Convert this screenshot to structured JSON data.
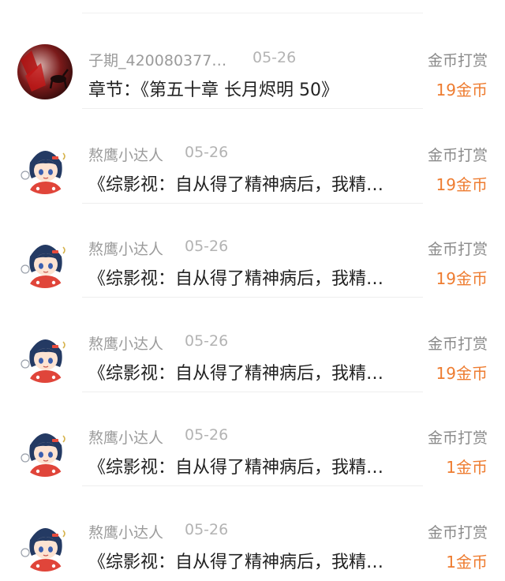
{
  "records": [
    {
      "user": "子期_420080377…",
      "date": "05-26",
      "title": "章节：《第五十章 长月烬明 50》",
      "type": "金币打赏",
      "amount": "19金币",
      "avatar": "dark-red-art"
    },
    {
      "user": "熬鹰小达人",
      "date": "05-26",
      "title": "《综影视：自从得了精神病后，我精…",
      "type": "金币打赏",
      "amount": "19金币",
      "avatar": "cartoon-girl"
    },
    {
      "user": "熬鹰小达人",
      "date": "05-26",
      "title": "《综影视：自从得了精神病后，我精…",
      "type": "金币打赏",
      "amount": "19金币",
      "avatar": "cartoon-girl"
    },
    {
      "user": "熬鹰小达人",
      "date": "05-26",
      "title": "《综影视：自从得了精神病后，我精…",
      "type": "金币打赏",
      "amount": "19金币",
      "avatar": "cartoon-girl"
    },
    {
      "user": "熬鹰小达人",
      "date": "05-26",
      "title": "《综影视：自从得了精神病后，我精…",
      "type": "金币打赏",
      "amount": "1金币",
      "avatar": "cartoon-girl"
    },
    {
      "user": "熬鹰小达人",
      "date": "05-26",
      "title": "《综影视：自从得了精神病后，我精…",
      "type": "金币打赏",
      "amount": "1金币",
      "avatar": "cartoon-girl"
    }
  ],
  "colors": {
    "amount": "#ee7c30",
    "type_label": "#8a8a8a",
    "user": "#9b9b9b",
    "title": "#222222"
  }
}
